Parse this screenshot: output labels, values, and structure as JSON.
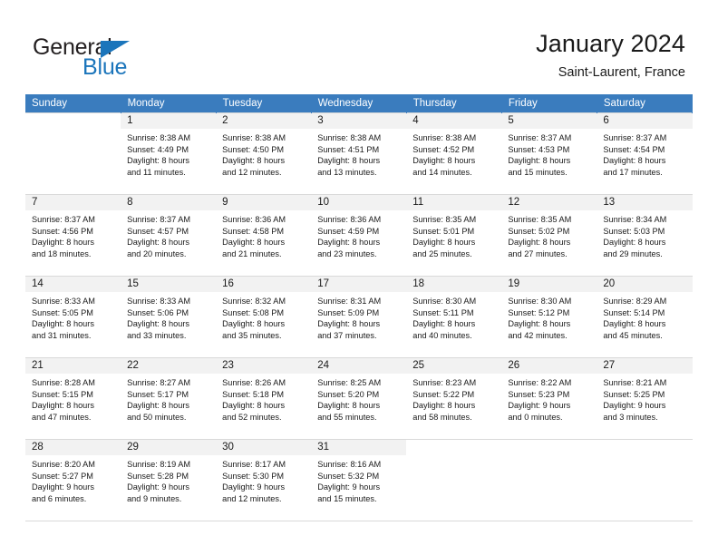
{
  "brand": {
    "name_part1": "General",
    "name_part2": "Blue",
    "accent_color": "#1b75bb",
    "triangle_icon": "brand-triangle-icon"
  },
  "header": {
    "title": "January 2024",
    "location": "Saint-Laurent, France"
  },
  "calendar": {
    "header_bg": "#3a7cbe",
    "header_text_color": "#ffffff",
    "daynum_bg": "#f2f2f2",
    "weekday_headers": [
      "Sunday",
      "Monday",
      "Tuesday",
      "Wednesday",
      "Thursday",
      "Friday",
      "Saturday"
    ],
    "labels": {
      "sunrise": "Sunrise:",
      "sunset": "Sunset:",
      "daylight": "Daylight:"
    },
    "weeks": [
      [
        {
          "day": "",
          "sunrise": "",
          "sunset": "",
          "daylight_l1": "",
          "daylight_l2": "",
          "empty": true
        },
        {
          "day": "1",
          "sunrise": "Sunrise: 8:38 AM",
          "sunset": "Sunset: 4:49 PM",
          "daylight_l1": "Daylight: 8 hours",
          "daylight_l2": "and 11 minutes."
        },
        {
          "day": "2",
          "sunrise": "Sunrise: 8:38 AM",
          "sunset": "Sunset: 4:50 PM",
          "daylight_l1": "Daylight: 8 hours",
          "daylight_l2": "and 12 minutes."
        },
        {
          "day": "3",
          "sunrise": "Sunrise: 8:38 AM",
          "sunset": "Sunset: 4:51 PM",
          "daylight_l1": "Daylight: 8 hours",
          "daylight_l2": "and 13 minutes."
        },
        {
          "day": "4",
          "sunrise": "Sunrise: 8:38 AM",
          "sunset": "Sunset: 4:52 PM",
          "daylight_l1": "Daylight: 8 hours",
          "daylight_l2": "and 14 minutes."
        },
        {
          "day": "5",
          "sunrise": "Sunrise: 8:37 AM",
          "sunset": "Sunset: 4:53 PM",
          "daylight_l1": "Daylight: 8 hours",
          "daylight_l2": "and 15 minutes."
        },
        {
          "day": "6",
          "sunrise": "Sunrise: 8:37 AM",
          "sunset": "Sunset: 4:54 PM",
          "daylight_l1": "Daylight: 8 hours",
          "daylight_l2": "and 17 minutes."
        }
      ],
      [
        {
          "day": "7",
          "sunrise": "Sunrise: 8:37 AM",
          "sunset": "Sunset: 4:56 PM",
          "daylight_l1": "Daylight: 8 hours",
          "daylight_l2": "and 18 minutes."
        },
        {
          "day": "8",
          "sunrise": "Sunrise: 8:37 AM",
          "sunset": "Sunset: 4:57 PM",
          "daylight_l1": "Daylight: 8 hours",
          "daylight_l2": "and 20 minutes."
        },
        {
          "day": "9",
          "sunrise": "Sunrise: 8:36 AM",
          "sunset": "Sunset: 4:58 PM",
          "daylight_l1": "Daylight: 8 hours",
          "daylight_l2": "and 21 minutes."
        },
        {
          "day": "10",
          "sunrise": "Sunrise: 8:36 AM",
          "sunset": "Sunset: 4:59 PM",
          "daylight_l1": "Daylight: 8 hours",
          "daylight_l2": "and 23 minutes."
        },
        {
          "day": "11",
          "sunrise": "Sunrise: 8:35 AM",
          "sunset": "Sunset: 5:01 PM",
          "daylight_l1": "Daylight: 8 hours",
          "daylight_l2": "and 25 minutes."
        },
        {
          "day": "12",
          "sunrise": "Sunrise: 8:35 AM",
          "sunset": "Sunset: 5:02 PM",
          "daylight_l1": "Daylight: 8 hours",
          "daylight_l2": "and 27 minutes."
        },
        {
          "day": "13",
          "sunrise": "Sunrise: 8:34 AM",
          "sunset": "Sunset: 5:03 PM",
          "daylight_l1": "Daylight: 8 hours",
          "daylight_l2": "and 29 minutes."
        }
      ],
      [
        {
          "day": "14",
          "sunrise": "Sunrise: 8:33 AM",
          "sunset": "Sunset: 5:05 PM",
          "daylight_l1": "Daylight: 8 hours",
          "daylight_l2": "and 31 minutes."
        },
        {
          "day": "15",
          "sunrise": "Sunrise: 8:33 AM",
          "sunset": "Sunset: 5:06 PM",
          "daylight_l1": "Daylight: 8 hours",
          "daylight_l2": "and 33 minutes."
        },
        {
          "day": "16",
          "sunrise": "Sunrise: 8:32 AM",
          "sunset": "Sunset: 5:08 PM",
          "daylight_l1": "Daylight: 8 hours",
          "daylight_l2": "and 35 minutes."
        },
        {
          "day": "17",
          "sunrise": "Sunrise: 8:31 AM",
          "sunset": "Sunset: 5:09 PM",
          "daylight_l1": "Daylight: 8 hours",
          "daylight_l2": "and 37 minutes."
        },
        {
          "day": "18",
          "sunrise": "Sunrise: 8:30 AM",
          "sunset": "Sunset: 5:11 PM",
          "daylight_l1": "Daylight: 8 hours",
          "daylight_l2": "and 40 minutes."
        },
        {
          "day": "19",
          "sunrise": "Sunrise: 8:30 AM",
          "sunset": "Sunset: 5:12 PM",
          "daylight_l1": "Daylight: 8 hours",
          "daylight_l2": "and 42 minutes."
        },
        {
          "day": "20",
          "sunrise": "Sunrise: 8:29 AM",
          "sunset": "Sunset: 5:14 PM",
          "daylight_l1": "Daylight: 8 hours",
          "daylight_l2": "and 45 minutes."
        }
      ],
      [
        {
          "day": "21",
          "sunrise": "Sunrise: 8:28 AM",
          "sunset": "Sunset: 5:15 PM",
          "daylight_l1": "Daylight: 8 hours",
          "daylight_l2": "and 47 minutes."
        },
        {
          "day": "22",
          "sunrise": "Sunrise: 8:27 AM",
          "sunset": "Sunset: 5:17 PM",
          "daylight_l1": "Daylight: 8 hours",
          "daylight_l2": "and 50 minutes."
        },
        {
          "day": "23",
          "sunrise": "Sunrise: 8:26 AM",
          "sunset": "Sunset: 5:18 PM",
          "daylight_l1": "Daylight: 8 hours",
          "daylight_l2": "and 52 minutes."
        },
        {
          "day": "24",
          "sunrise": "Sunrise: 8:25 AM",
          "sunset": "Sunset: 5:20 PM",
          "daylight_l1": "Daylight: 8 hours",
          "daylight_l2": "and 55 minutes."
        },
        {
          "day": "25",
          "sunrise": "Sunrise: 8:23 AM",
          "sunset": "Sunset: 5:22 PM",
          "daylight_l1": "Daylight: 8 hours",
          "daylight_l2": "and 58 minutes."
        },
        {
          "day": "26",
          "sunrise": "Sunrise: 8:22 AM",
          "sunset": "Sunset: 5:23 PM",
          "daylight_l1": "Daylight: 9 hours",
          "daylight_l2": "and 0 minutes."
        },
        {
          "day": "27",
          "sunrise": "Sunrise: 8:21 AM",
          "sunset": "Sunset: 5:25 PM",
          "daylight_l1": "Daylight: 9 hours",
          "daylight_l2": "and 3 minutes."
        }
      ],
      [
        {
          "day": "28",
          "sunrise": "Sunrise: 8:20 AM",
          "sunset": "Sunset: 5:27 PM",
          "daylight_l1": "Daylight: 9 hours",
          "daylight_l2": "and 6 minutes."
        },
        {
          "day": "29",
          "sunrise": "Sunrise: 8:19 AM",
          "sunset": "Sunset: 5:28 PM",
          "daylight_l1": "Daylight: 9 hours",
          "daylight_l2": "and 9 minutes."
        },
        {
          "day": "30",
          "sunrise": "Sunrise: 8:17 AM",
          "sunset": "Sunset: 5:30 PM",
          "daylight_l1": "Daylight: 9 hours",
          "daylight_l2": "and 12 minutes."
        },
        {
          "day": "31",
          "sunrise": "Sunrise: 8:16 AM",
          "sunset": "Sunset: 5:32 PM",
          "daylight_l1": "Daylight: 9 hours",
          "daylight_l2": "and 15 minutes."
        },
        {
          "day": "",
          "sunrise": "",
          "sunset": "",
          "daylight_l1": "",
          "daylight_l2": "",
          "empty": true
        },
        {
          "day": "",
          "sunrise": "",
          "sunset": "",
          "daylight_l1": "",
          "daylight_l2": "",
          "empty": true
        },
        {
          "day": "",
          "sunrise": "",
          "sunset": "",
          "daylight_l1": "",
          "daylight_l2": "",
          "empty": true
        }
      ]
    ]
  }
}
